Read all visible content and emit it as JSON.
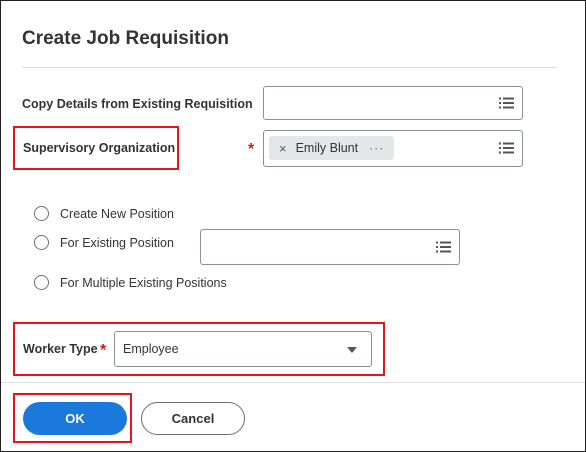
{
  "dialog": {
    "title": "Create Job Requisition"
  },
  "fields": {
    "copy_details": {
      "label": "Copy Details from Existing Requisition",
      "value": ""
    },
    "supervisory_org": {
      "label": "Supervisory Organization",
      "required": "*",
      "selected": "Emily Blunt",
      "remove_glyph": "×",
      "more_glyph": "···"
    },
    "position_options": [
      {
        "label": "Create New Position",
        "selected": false
      },
      {
        "label": "For Existing Position",
        "selected": false
      },
      {
        "label": "For Multiple Existing Positions",
        "selected": false
      }
    ],
    "existing_position": {
      "value": ""
    },
    "worker_type": {
      "label": "Worker Type",
      "required": "*",
      "value": "Employee"
    }
  },
  "buttons": {
    "ok": "OK",
    "cancel": "Cancel"
  },
  "colors": {
    "primary": "#1b79db",
    "required": "#d01b1b",
    "highlight": "#e8141c"
  },
  "icons": {
    "prompt": "list-icon",
    "dropdown": "chevron-down-icon",
    "remove": "close-icon",
    "more": "more-icon"
  }
}
